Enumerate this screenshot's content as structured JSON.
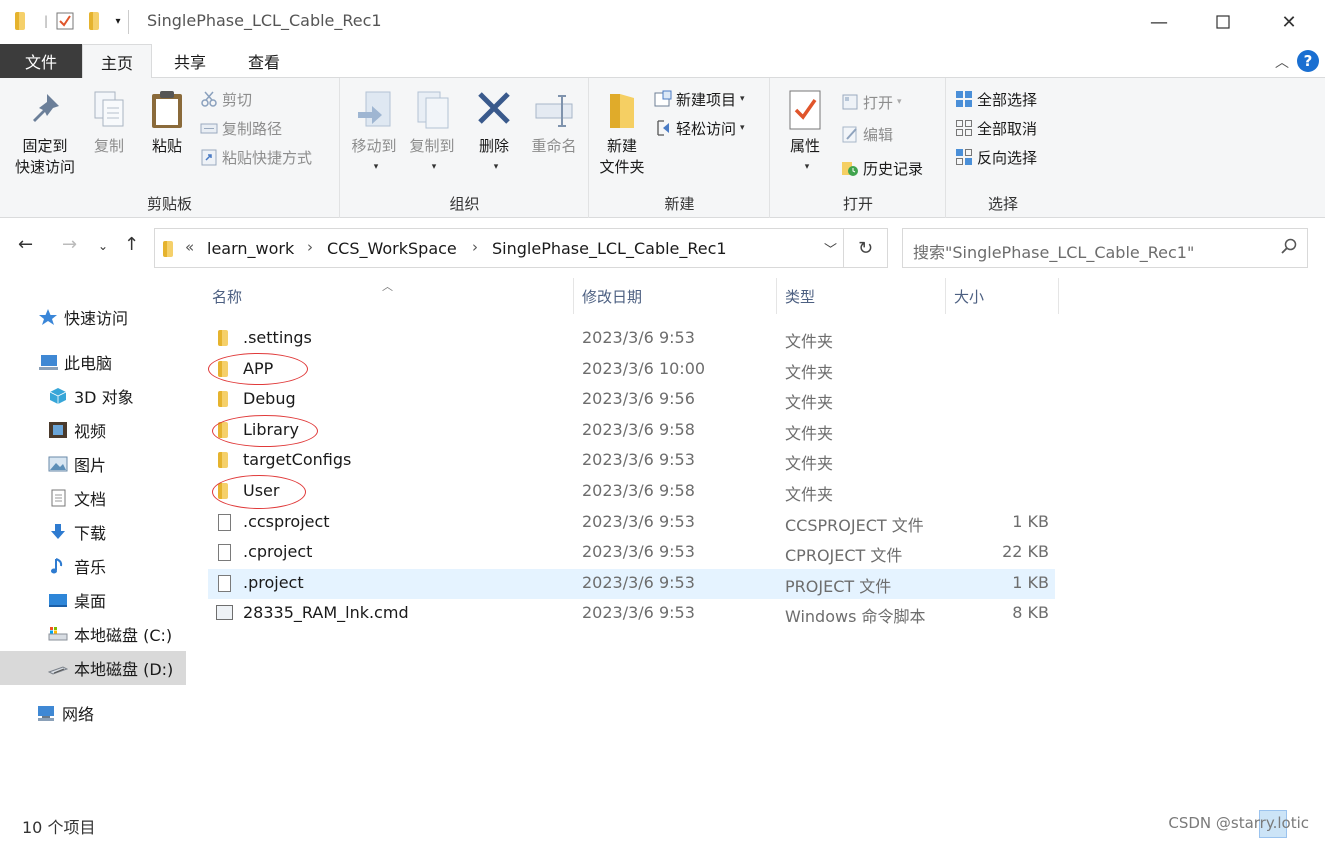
{
  "window": {
    "title": "SinglePhase_LCL_Cable_Rec1",
    "minimize": "—",
    "maximize": "☐",
    "close": "✕"
  },
  "ribbon_tabs": {
    "file": "文件",
    "home": "主页",
    "share": "共享",
    "view": "查看"
  },
  "ribbon": {
    "clipboard": {
      "label": "剪贴板",
      "pin": "固定到\n快速访问",
      "pin_l1": "固定到",
      "pin_l2": "快速访问",
      "copy": "复制",
      "paste": "粘贴",
      "cut": "剪切",
      "copy_path": "复制路径",
      "paste_shortcut": "粘贴快捷方式"
    },
    "organize": {
      "label": "组织",
      "move_to": "移动到",
      "copy_to": "复制到",
      "delete": "删除",
      "rename": "重命名"
    },
    "new": {
      "label": "新建",
      "new_folder_l1": "新建",
      "new_folder_l2": "文件夹",
      "new_item": "新建项目",
      "easy_access": "轻松访问"
    },
    "open": {
      "label": "打开",
      "properties": "属性",
      "open": "打开",
      "edit": "编辑",
      "history": "历史记录"
    },
    "select": {
      "label": "选择",
      "select_all": "全部选择",
      "select_none": "全部取消",
      "invert": "反向选择"
    }
  },
  "address": {
    "overflow": "«",
    "crumbs": [
      "learn_work",
      "CCS_WorkSpace",
      "SinglePhase_LCL_Cable_Rec1"
    ],
    "search_placeholder": "搜索\"SinglePhase_LCL_Cable_Rec1\""
  },
  "nav": {
    "items": [
      {
        "label": "快速访问",
        "icon": "star-icon"
      },
      {
        "label": "此电脑",
        "icon": "computer-icon"
      },
      {
        "label": "3D 对象",
        "icon": "cube-icon"
      },
      {
        "label": "视频",
        "icon": "video-icon"
      },
      {
        "label": "图片",
        "icon": "picture-icon"
      },
      {
        "label": "文档",
        "icon": "document-icon"
      },
      {
        "label": "下载",
        "icon": "download-icon"
      },
      {
        "label": "音乐",
        "icon": "music-icon"
      },
      {
        "label": "桌面",
        "icon": "desktop-icon"
      },
      {
        "label": "本地磁盘 (C:)",
        "icon": "drive-icon"
      },
      {
        "label": "本地磁盘 (D:)",
        "icon": "drive-icon"
      },
      {
        "label": "网络",
        "icon": "network-icon"
      }
    ]
  },
  "columns": {
    "name": "名称",
    "date": "修改日期",
    "type": "类型",
    "size": "大小"
  },
  "files": [
    {
      "name": ".settings",
      "date": "2023/3/6 9:53",
      "type": "文件夹",
      "size": "",
      "kind": "folder"
    },
    {
      "name": "APP",
      "date": "2023/3/6 10:00",
      "type": "文件夹",
      "size": "",
      "kind": "folder"
    },
    {
      "name": "Debug",
      "date": "2023/3/6 9:56",
      "type": "文件夹",
      "size": "",
      "kind": "folder"
    },
    {
      "name": "Library",
      "date": "2023/3/6 9:58",
      "type": "文件夹",
      "size": "",
      "kind": "folder"
    },
    {
      "name": "targetConfigs",
      "date": "2023/3/6 9:53",
      "type": "文件夹",
      "size": "",
      "kind": "folder"
    },
    {
      "name": "User",
      "date": "2023/3/6 9:58",
      "type": "文件夹",
      "size": "",
      "kind": "folder"
    },
    {
      "name": ".ccsproject",
      "date": "2023/3/6 9:53",
      "type": "CCSPROJECT 文件",
      "size": "1 KB",
      "kind": "file"
    },
    {
      "name": ".cproject",
      "date": "2023/3/6 9:53",
      "type": "CPROJECT 文件",
      "size": "22 KB",
      "kind": "file"
    },
    {
      "name": ".project",
      "date": "2023/3/6 9:53",
      "type": "PROJECT 文件",
      "size": "1 KB",
      "kind": "file"
    },
    {
      "name": "28335_RAM_lnk.cmd",
      "date": "2023/3/6 9:53",
      "type": "Windows 命令脚本",
      "size": "8 KB",
      "kind": "cmd"
    }
  ],
  "status": {
    "count": "10 个项目",
    "watermark": "CSDN @starry.lotic"
  },
  "colors": {
    "accent": "#1a6fd1",
    "selected_row": "#e5f3ff",
    "annotation": "#e03a3a",
    "folder": "#f2c94c"
  }
}
